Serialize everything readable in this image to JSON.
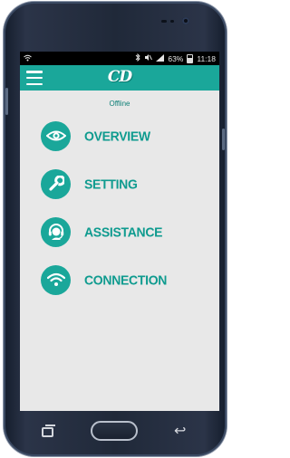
{
  "status_bar": {
    "wifi_icon": "wifi-icon",
    "bluetooth_icon": "bluetooth-icon",
    "mute_icon": "mute-icon",
    "signal_icon": "signal-icon",
    "battery_percent": "63%",
    "time": "11:18"
  },
  "app_bar": {
    "logo_text": "CD",
    "menu_icon": "hamburger-menu-icon",
    "accent_color": "#1aa79a"
  },
  "connection_status": "Offline",
  "menu": {
    "items": [
      {
        "label": "OVERVIEW",
        "icon": "eye-icon"
      },
      {
        "label": "SETTING",
        "icon": "wrench-icon"
      },
      {
        "label": "ASSISTANCE",
        "icon": "headset-icon"
      },
      {
        "label": "CONNECTION",
        "icon": "wifi-icon"
      }
    ]
  },
  "navigation_bar": {
    "recent_icon": "recent-apps-icon",
    "home_icon": "home-button",
    "back_icon": "back-icon"
  }
}
